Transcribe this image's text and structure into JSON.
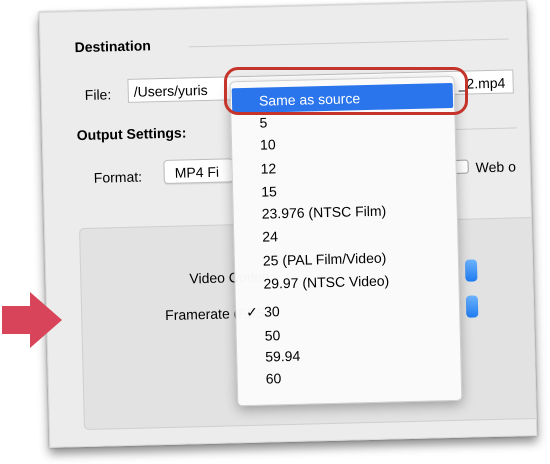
{
  "destination": {
    "label": "Destination",
    "file_label": "File:",
    "file_value": "/Users/yuris",
    "file_suffix": "_2.mp4"
  },
  "output_settings": {
    "label": "Output Settings:",
    "format_label": "Format:",
    "format_value": "MP4 Fi",
    "web_label": "Web o"
  },
  "settings": {
    "video_codec_label": "Video Codec",
    "framerate_label": "Framerate (FPS)"
  },
  "framerate_menu": {
    "items": [
      "Same as source",
      "5",
      "10",
      "12",
      "15",
      "23.976 (NTSC Film)",
      "24",
      "25 (PAL Film/Video)",
      "29.97 (NTSC Video)",
      "30",
      "50",
      "59.94",
      "60"
    ],
    "highlighted_item": "Same as source",
    "checked_item": "30",
    "check_mark": "✓"
  },
  "colors": {
    "highlight": "#2a74ec",
    "callout": "#c5342b",
    "arrow": "#d8455a"
  }
}
